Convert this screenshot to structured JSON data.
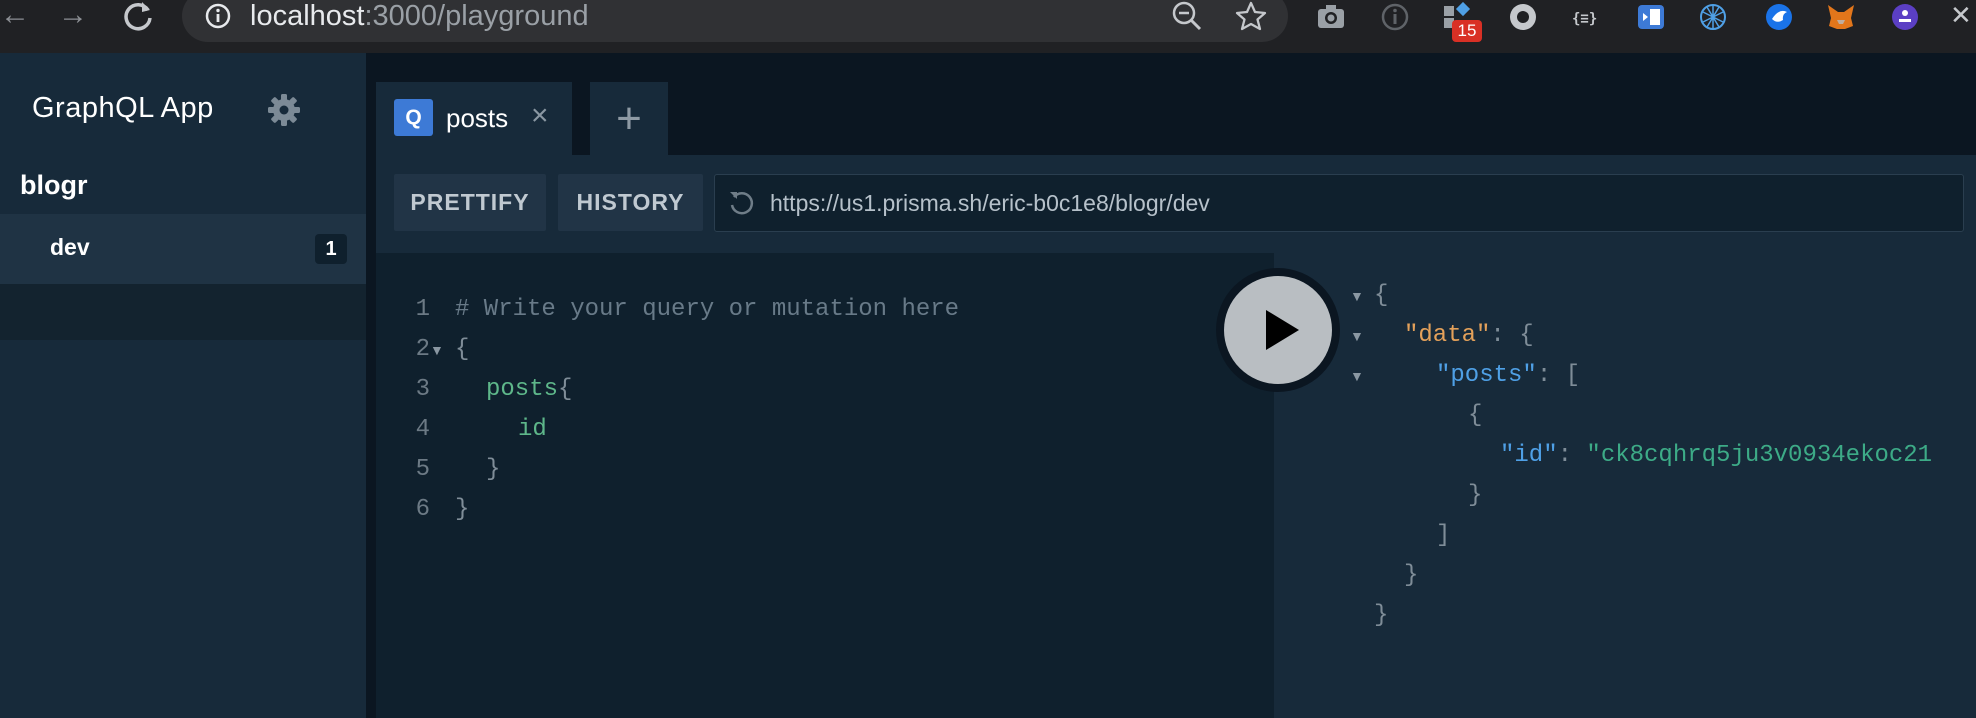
{
  "browser": {
    "url_host": "localhost",
    "url_rest": ":3000/playground",
    "extension_badge": "15"
  },
  "sidebar": {
    "app_title": "GraphQL App",
    "project": "blogr",
    "stage": {
      "name": "dev",
      "count": "1"
    }
  },
  "tabs": [
    {
      "badge": "Q",
      "label": "posts"
    }
  ],
  "toolbar": {
    "prettify_label": "PRETTIFY",
    "history_label": "HISTORY",
    "endpoint_url": "https://us1.prisma.sh/eric-b0c1e8/blogr/dev"
  },
  "editor": {
    "line_numbers": [
      "1",
      "2",
      "3",
      "4",
      "5",
      "6"
    ],
    "comment": "# Write your query or mutation here",
    "open_brace": "{",
    "query_field": "posts",
    "query_field_brace": "{",
    "sub_field": "id",
    "inner_close": "}",
    "outer_close": "}"
  },
  "result": {
    "open_brace": "{",
    "data_key": "\"data\"",
    "data_sep": ": {",
    "posts_key": "\"posts\"",
    "posts_sep": ": [",
    "item_open": "{",
    "id_key": "\"id\"",
    "id_sep": ": ",
    "id_value": "\"ck8cqhrq5ju3v0934ekoc21",
    "item_close": "}",
    "array_close": "]",
    "data_close": "}",
    "root_close": "}"
  },
  "colors": {
    "background": "#0f202d",
    "panel": "#172a3a",
    "accent_blue": "#3d7ad6",
    "field_green": "#5eb78a",
    "key_orange": "#e4a15a",
    "key_blue": "#4fa0e6"
  }
}
